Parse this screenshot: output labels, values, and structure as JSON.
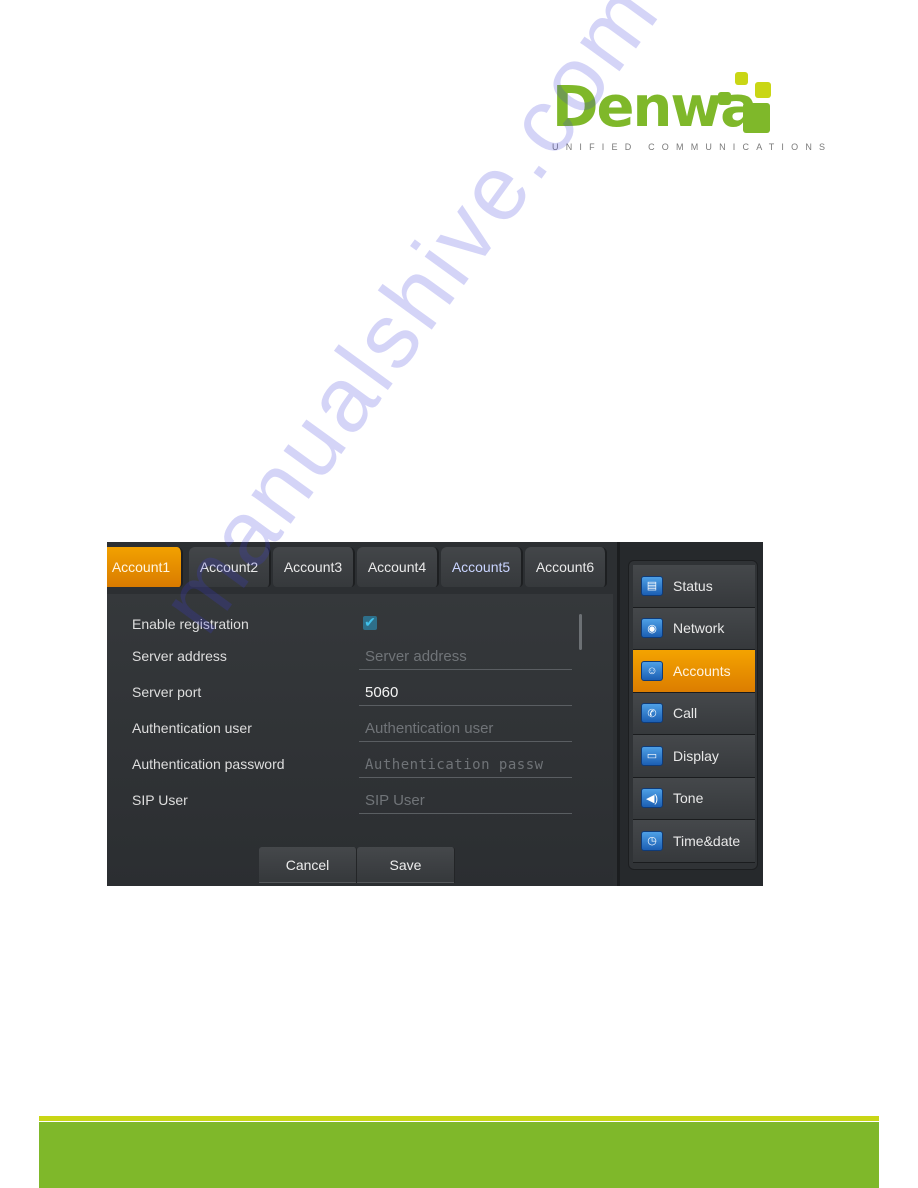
{
  "logo": {
    "brand": "Denwa",
    "tagline": "UNIFIED COMMUNICATIONS",
    "colors": {
      "primary": "#7fb82a",
      "accent": "#c9d615"
    }
  },
  "screen": {
    "tabs": [
      {
        "label": "Account1",
        "active": true
      },
      {
        "label": "Account2",
        "active": false
      },
      {
        "label": "Account3",
        "active": false
      },
      {
        "label": "Account4",
        "active": false
      },
      {
        "label": "Account5",
        "active": false
      },
      {
        "label": "Account6",
        "active": false
      }
    ],
    "form": {
      "enable_registration": {
        "label": "Enable registration",
        "checked": true,
        "check_glyph": "✔"
      },
      "server_address": {
        "label": "Server address",
        "value": "",
        "placeholder": "Server address"
      },
      "server_port": {
        "label": "Server port",
        "value": "5060",
        "placeholder": ""
      },
      "auth_user": {
        "label": "Authentication user",
        "value": "",
        "placeholder": "Authentication user"
      },
      "auth_password": {
        "label": "Authentication password",
        "value": "",
        "placeholder": "Authentication passw"
      },
      "sip_user": {
        "label": "SIP User",
        "value": "",
        "placeholder": "SIP User"
      }
    },
    "buttons": {
      "cancel": "Cancel",
      "save": "Save"
    },
    "sidebar": {
      "items": [
        {
          "label": "Status",
          "icon": "status-icon",
          "glyph": "▤",
          "active": false
        },
        {
          "label": "Network",
          "icon": "network-globe-icon",
          "glyph": "◉",
          "active": false
        },
        {
          "label": "Accounts",
          "icon": "accounts-users-icon",
          "glyph": "☺",
          "active": true
        },
        {
          "label": "Call",
          "icon": "call-handset-icon",
          "glyph": "✆",
          "active": false
        },
        {
          "label": "Display",
          "icon": "display-monitor-icon",
          "glyph": "▭",
          "active": false
        },
        {
          "label": "Tone",
          "icon": "tone-speaker-icon",
          "glyph": "◀)",
          "active": false
        },
        {
          "label": "Time&date",
          "icon": "clock-icon",
          "glyph": "◷",
          "active": false
        }
      ]
    },
    "colors": {
      "active": "#f2a100",
      "panel": "#2c2f32"
    }
  },
  "watermark": "manualshive.com",
  "footer": {
    "colors": {
      "bar": "#7fb82a",
      "line": "#c9d615"
    }
  }
}
